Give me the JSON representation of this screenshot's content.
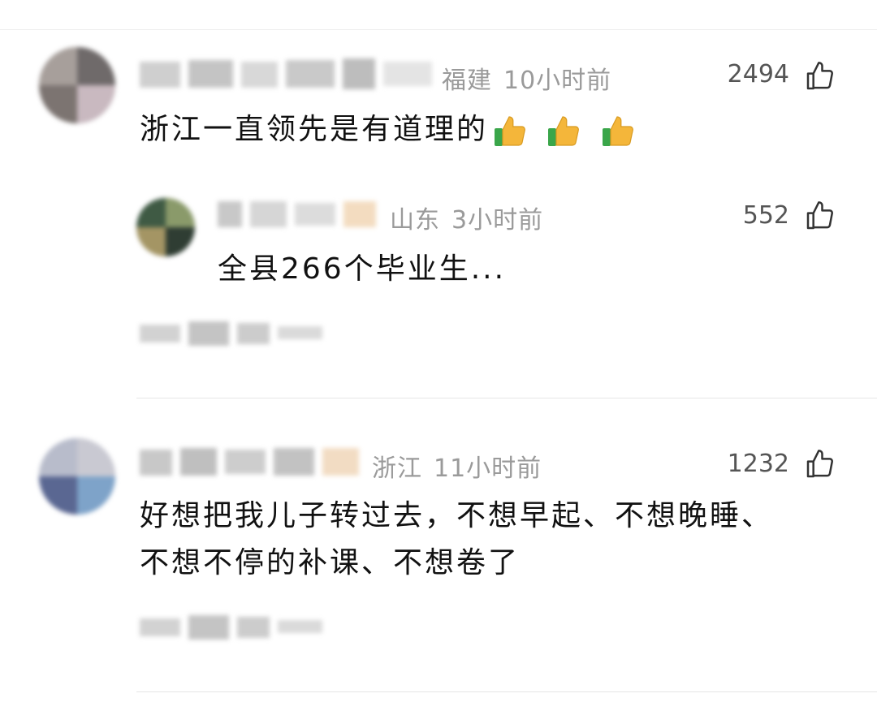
{
  "comments": [
    {
      "location": "福建",
      "time": "10小时前",
      "likes": "2494",
      "text": "浙江一直领先是有道理的",
      "emoji": [
        "thumbs-up",
        "thumbs-up",
        "thumbs-up"
      ],
      "reply": {
        "location": "山东",
        "time": "3小时前",
        "likes": "552",
        "text": "全县266个毕业生..."
      }
    },
    {
      "location": "浙江",
      "time": "11小时前",
      "likes": "1232",
      "text_line1": "好想把我儿子转过去，不想早起、不想晚睡、",
      "text_line2": "不想不停的补课、不想卷了"
    }
  ],
  "icons": {
    "like": "thumbs-up-outline-icon",
    "emoji": "thumbs-up-emoji-icon"
  },
  "colors": {
    "meta_text": "#9a9a9a",
    "body_text": "#111111",
    "divider": "#e6e6e6",
    "emoji_yellow": "#f4b63a",
    "emoji_green": "#3aa64a"
  }
}
